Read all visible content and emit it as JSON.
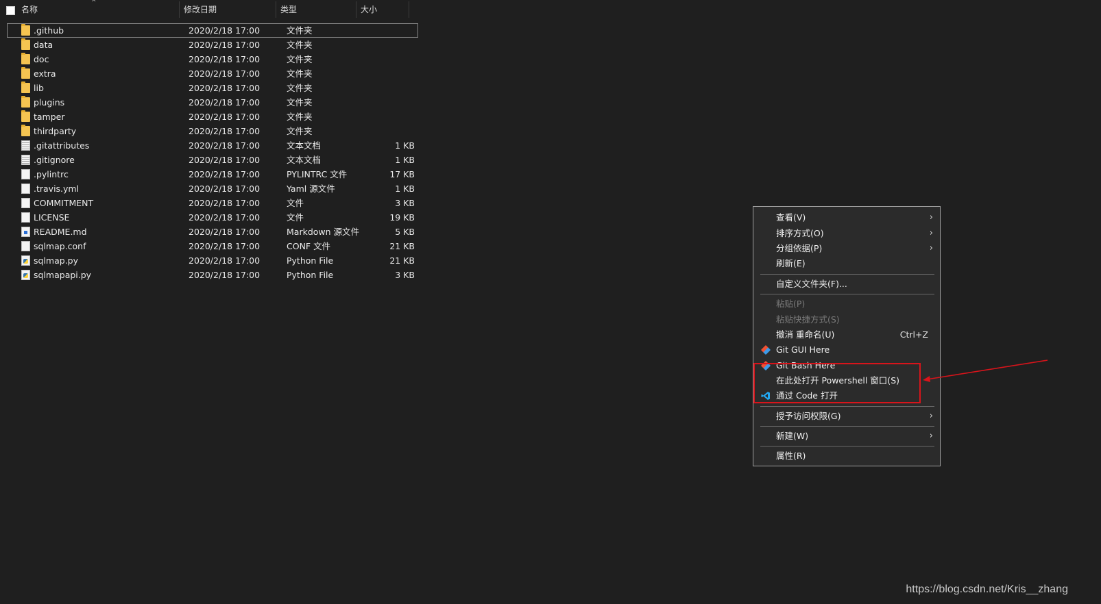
{
  "header": {
    "columns": [
      "名称",
      "修改日期",
      "类型",
      "大小"
    ],
    "sort_indicator": "^"
  },
  "files": [
    {
      "name": ".github",
      "date": "2020/2/18 17:00",
      "type": "文件夹",
      "size": "",
      "icon": "folder-icon"
    },
    {
      "name": "data",
      "date": "2020/2/18 17:00",
      "type": "文件夹",
      "size": "",
      "icon": "folder-icon"
    },
    {
      "name": "doc",
      "date": "2020/2/18 17:00",
      "type": "文件夹",
      "size": "",
      "icon": "folder-icon"
    },
    {
      "name": "extra",
      "date": "2020/2/18 17:00",
      "type": "文件夹",
      "size": "",
      "icon": "folder-icon"
    },
    {
      "name": "lib",
      "date": "2020/2/18 17:00",
      "type": "文件夹",
      "size": "",
      "icon": "folder-icon"
    },
    {
      "name": "plugins",
      "date": "2020/2/18 17:00",
      "type": "文件夹",
      "size": "",
      "icon": "folder-icon"
    },
    {
      "name": "tamper",
      "date": "2020/2/18 17:00",
      "type": "文件夹",
      "size": "",
      "icon": "folder-icon"
    },
    {
      "name": "thirdparty",
      "date": "2020/2/18 17:00",
      "type": "文件夹",
      "size": "",
      "icon": "folder-icon"
    },
    {
      "name": ".gitattributes",
      "date": "2020/2/18 17:00",
      "type": "文本文档",
      "size": "1 KB",
      "icon": "text-document-icon"
    },
    {
      "name": ".gitignore",
      "date": "2020/2/18 17:00",
      "type": "文本文档",
      "size": "1 KB",
      "icon": "text-document-icon"
    },
    {
      "name": ".pylintrc",
      "date": "2020/2/18 17:00",
      "type": "PYLINTRC 文件",
      "size": "17 KB",
      "icon": "file-icon"
    },
    {
      "name": ".travis.yml",
      "date": "2020/2/18 17:00",
      "type": "Yaml 源文件",
      "size": "1 KB",
      "icon": "yaml-file-icon"
    },
    {
      "name": "COMMITMENT",
      "date": "2020/2/18 17:00",
      "type": "文件",
      "size": "3 KB",
      "icon": "file-icon"
    },
    {
      "name": "LICENSE",
      "date": "2020/2/18 17:00",
      "type": "文件",
      "size": "19 KB",
      "icon": "file-icon"
    },
    {
      "name": "README.md",
      "date": "2020/2/18 17:00",
      "type": "Markdown 源文件",
      "size": "5 KB",
      "icon": "markdown-file-icon"
    },
    {
      "name": "sqlmap.conf",
      "date": "2020/2/18 17:00",
      "type": "CONF 文件",
      "size": "21 KB",
      "icon": "file-icon"
    },
    {
      "name": "sqlmap.py",
      "date": "2020/2/18 17:00",
      "type": "Python File",
      "size": "21 KB",
      "icon": "python-file-icon"
    },
    {
      "name": "sqlmapapi.py",
      "date": "2020/2/18 17:00",
      "type": "Python File",
      "size": "3 KB",
      "icon": "python-file-icon"
    }
  ],
  "context_menu": {
    "items": [
      {
        "label": "查看(V)",
        "submenu": true
      },
      {
        "label": "排序方式(O)",
        "submenu": true
      },
      {
        "label": "分组依据(P)",
        "submenu": true
      },
      {
        "label": "刷新(E)"
      },
      {
        "label": "自定义文件夹(F)..."
      },
      {
        "label": "粘贴(P)",
        "disabled": true
      },
      {
        "label": "粘贴快捷方式(S)",
        "disabled": true
      },
      {
        "label": "撤消 重命名(U)",
        "shortcut": "Ctrl+Z"
      },
      {
        "label": "Git GUI Here",
        "icon": "git-gui-icon"
      },
      {
        "label": "Git Bash Here",
        "icon": "git-bash-icon"
      },
      {
        "label": "在此处打开 Powershell 窗口(S)"
      },
      {
        "label": "通过 Code 打开",
        "icon": "vscode-icon"
      },
      {
        "label": "授予访问权限(G)",
        "submenu": true
      },
      {
        "label": "新建(W)",
        "submenu": true
      },
      {
        "label": "属性(R)"
      }
    ],
    "submenu_glyph": "›"
  },
  "watermark": "https://blog.csdn.net/Kris__zhang",
  "colors": {
    "background": "#1f1f1f",
    "menu_background": "#2b2b2b",
    "annotation_red": "#d8141b",
    "folder_yellow": "#f5c451"
  }
}
